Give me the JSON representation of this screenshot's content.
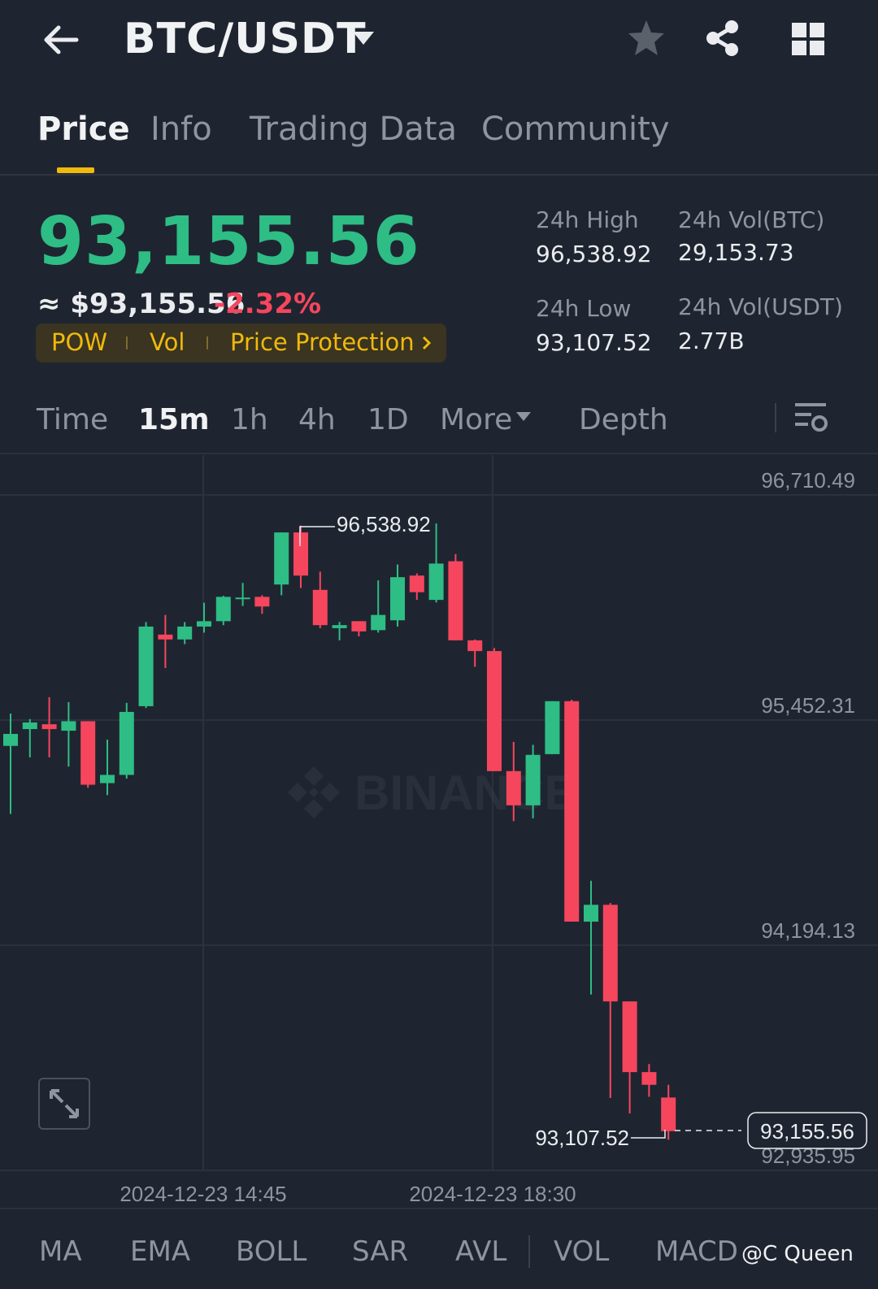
{
  "header": {
    "pair": "BTC/USDT"
  },
  "tabs": [
    {
      "label": "Price",
      "active": true
    },
    {
      "label": "Info",
      "active": false
    },
    {
      "label": "Trading Data",
      "active": false
    },
    {
      "label": "Community",
      "active": false
    }
  ],
  "ticker": {
    "last_price": "93,155.56",
    "usd_price": "≈ $93,155.56",
    "change": "-2.32%",
    "tags": [
      "POW",
      "Vol",
      "Price Protection"
    ],
    "high_label": "24h High",
    "high_value": "96,538.92",
    "low_label": "24h Low",
    "low_value": "93,107.52",
    "vol_btc_label": "24h Vol(BTC)",
    "vol_btc_value": "29,153.73",
    "vol_usdt_label": "24h Vol(USDT)",
    "vol_usdt_value": "2.77B"
  },
  "intervals": {
    "items": [
      "Time",
      "15m",
      "1h",
      "4h",
      "1D",
      "More",
      "Depth"
    ],
    "active": "15m"
  },
  "chart_data": {
    "type": "candlestick",
    "watermark": "BINANCE",
    "y_ticks": [
      "96,710.49",
      "95,452.31",
      "94,194.13",
      "92,935.95"
    ],
    "y_range": [
      92935.95,
      96710.49
    ],
    "x_ticks": [
      "2024-12-23 14:45",
      "2024-12-23 18:30"
    ],
    "high_marker": "96,538.92",
    "low_marker": "93,107.52",
    "last_price_marker": "93,155.56",
    "colors": {
      "up": "#2ebd85",
      "down": "#f6465d"
    },
    "candles": [
      {
        "o": 95308,
        "h": 95489,
        "c": 95375,
        "l": 94928
      },
      {
        "o": 95402,
        "h": 95458,
        "c": 95439,
        "l": 95244
      },
      {
        "o": 95429,
        "h": 95580,
        "c": 95402,
        "l": 95244
      },
      {
        "o": 95393,
        "h": 95553,
        "c": 95446,
        "l": 95192
      },
      {
        "o": 95446,
        "h": 95446,
        "c": 95091,
        "l": 95074
      },
      {
        "o": 95100,
        "h": 95343,
        "c": 95146,
        "l": 95033
      },
      {
        "o": 95146,
        "h": 95548,
        "c": 95498,
        "l": 95125
      },
      {
        "o": 95530,
        "h": 96000,
        "c": 95975,
        "l": 95520
      },
      {
        "o": 95930,
        "h": 96040,
        "c": 95903,
        "l": 95743
      },
      {
        "o": 95903,
        "h": 96000,
        "c": 95975,
        "l": 95877
      },
      {
        "o": 95975,
        "h": 96108,
        "c": 96005,
        "l": 95941
      },
      {
        "o": 96005,
        "h": 96147,
        "c": 96141,
        "l": 95983
      },
      {
        "o": 96137,
        "h": 96219,
        "c": 96137,
        "l": 96090
      },
      {
        "o": 96141,
        "h": 96150,
        "c": 96087,
        "l": 96046
      },
      {
        "o": 96210,
        "h": 96491,
        "c": 96501,
        "l": 96150
      },
      {
        "o": 96501,
        "h": 96539,
        "c": 96260,
        "l": 96190
      },
      {
        "o": 96180,
        "h": 96282,
        "c": 95983,
        "l": 95966
      },
      {
        "o": 95966,
        "h": 96001,
        "c": 95983,
        "l": 95898
      },
      {
        "o": 96005,
        "h": 96001,
        "c": 95948,
        "l": 95920
      },
      {
        "o": 95955,
        "h": 96233,
        "c": 96040,
        "l": 95941
      },
      {
        "o": 96010,
        "h": 96322,
        "c": 96251,
        "l": 95975
      },
      {
        "o": 96260,
        "h": 96272,
        "c": 96167,
        "l": 96124
      },
      {
        "o": 96124,
        "h": 96551,
        "c": 96327,
        "l": 96110
      },
      {
        "o": 96340,
        "h": 96380,
        "c": 95898,
        "l": 95902
      },
      {
        "o": 95898,
        "h": 95903,
        "c": 95838,
        "l": 95750
      },
      {
        "o": 95838,
        "h": 95855,
        "c": 95167,
        "l": 95167
      },
      {
        "o": 95167,
        "h": 95330,
        "c": 94976,
        "l": 94888
      },
      {
        "o": 94976,
        "h": 95314,
        "c": 95258,
        "l": 94903
      },
      {
        "o": 95262,
        "h": 95495,
        "c": 95558,
        "l": 95262
      },
      {
        "o": 95558,
        "h": 95566,
        "c": 94326,
        "l": 94326
      },
      {
        "o": 94326,
        "h": 94554,
        "c": 94420,
        "l": 93919
      },
      {
        "o": 94420,
        "h": 94430,
        "c": 93880,
        "l": 93340
      },
      {
        "o": 93880,
        "h": 93782,
        "c": 93485,
        "l": 93254
      },
      {
        "o": 93485,
        "h": 93530,
        "c": 93414,
        "l": 93347
      },
      {
        "o": 93343,
        "h": 93414,
        "c": 93155,
        "l": 93107
      }
    ]
  },
  "indicators": [
    "MA",
    "EMA",
    "BOLL",
    "SAR",
    "AVL",
    "VOL",
    "MACD"
  ],
  "watermark_user": "@C Queen"
}
